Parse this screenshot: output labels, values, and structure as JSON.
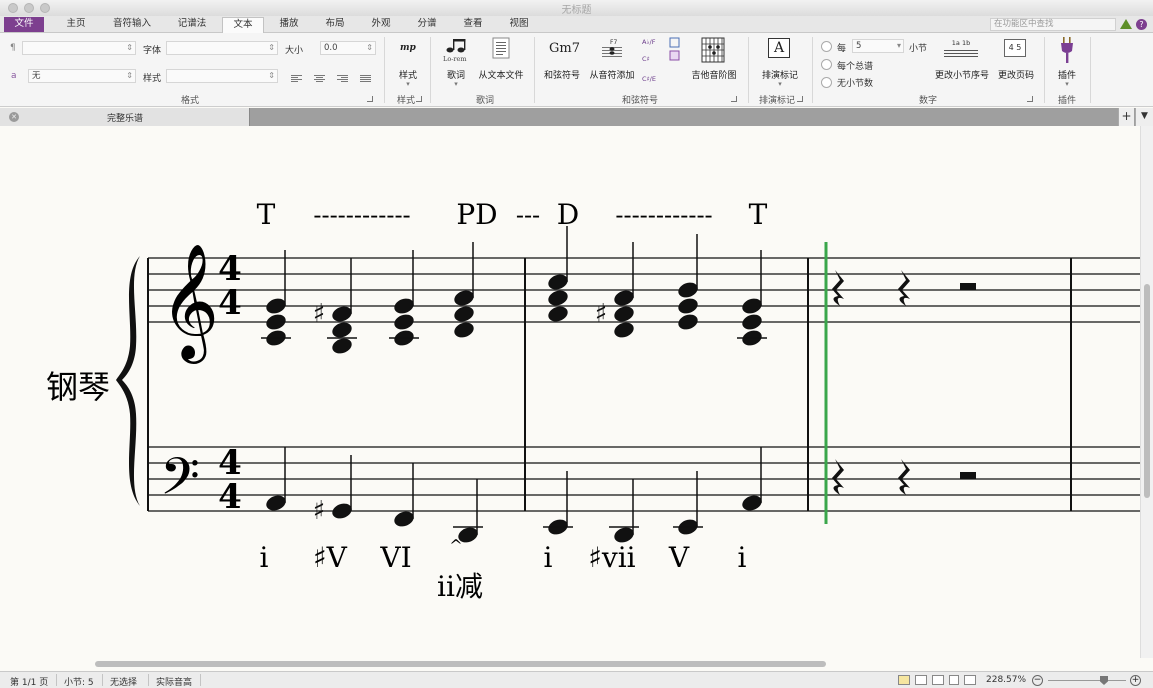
{
  "window": {
    "title": "无标题"
  },
  "ribbon_tabs": [
    "文件",
    "主页",
    "音符输入",
    "记谱法",
    "文本",
    "播放",
    "布局",
    "外观",
    "分谱",
    "查看",
    "视图"
  ],
  "ribbon_search": {
    "placeholder": "在功能区中查找"
  },
  "ribbon": {
    "format": {
      "paragraph_style_value": "",
      "char_style_value": "无",
      "font_label": "字体",
      "font_value": "",
      "size_label": "大小",
      "size_value": "0.0",
      "style_label": "样式",
      "style_value": "",
      "label": "格式"
    },
    "styles": {
      "button": "样式",
      "label": "样式"
    },
    "lyrics": {
      "lyric_button": "歌词",
      "from_text_button": "从文本文件",
      "label": "歌词",
      "lyric_icon_text": "Lo-rem"
    },
    "chord_symbols": {
      "chord_button": "和弦符号",
      "from_notes_button": "从音符添加",
      "guitar_button": "吉他音阶图",
      "label": "和弦符号",
      "chord_icon_text": "Gm7",
      "small_icon_1": "A♭/F",
      "small_icon_2": "C♯/E"
    },
    "rehearsal": {
      "button": "排演标记",
      "label": "排演标记",
      "icon_text": "A"
    },
    "numbering": {
      "every_label": "每",
      "every_value": "5",
      "bar_label": "小节",
      "every_system_label": "每个总谱",
      "no_numbers_label": "无小节数",
      "change_bar_button": "更改小节序号",
      "change_page_button": "更改页码",
      "change_bar_icon": "1a 1b",
      "change_page_icon": "4 5",
      "label": "数字"
    },
    "plugins": {
      "button": "插件",
      "label": "插件"
    }
  },
  "document_tab": {
    "title": "完整乐谱"
  },
  "score": {
    "instrument": "钢琴",
    "function_labels": [
      "T",
      "PD",
      "D",
      "T"
    ],
    "function_dashes": [
      "------------",
      "---",
      "------------"
    ],
    "roman_numerals": [
      "i",
      "♯V",
      "VI",
      "ii减",
      "i",
      "♯vii",
      "V",
      "i"
    ],
    "accent_mark": "^",
    "time_signature": {
      "beats": "4",
      "beat_type": "4"
    },
    "cursor_color": "#3aa64b"
  },
  "status": {
    "page": "第 1/1 页",
    "bar": "小节: 5",
    "selection": "无选择",
    "pitch": "实际音高",
    "zoom": "228.57%"
  },
  "colors": {
    "file_tab": "#7d3f8f",
    "accent": "#3aa64b"
  }
}
